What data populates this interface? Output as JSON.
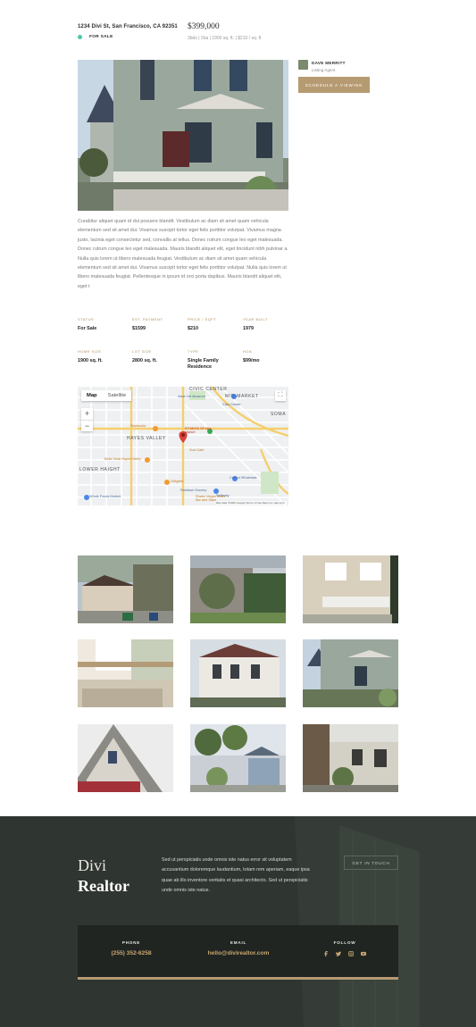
{
  "listing": {
    "address": "1234 Divi St, San Francisco, CA 92351",
    "status_badge": "FOR SALE",
    "price": "$399,000",
    "specs": "3bds | 2ba | 1900 sq. ft. | $210 / sq. ft"
  },
  "agent": {
    "name": "DAVE MERRITT",
    "role": "Listing Agent",
    "schedule_label": "SCHEDULE A VIEWING"
  },
  "description": "Curabitur aliquet quam id dui posuere blandit. Vestibulum ac diam sit amet quam vehicula elementum sed sit amet dui. Vivamus suscipit tortor eget felis porttitor volutpat. Vivamus magna justo, lacinia eget consectetur sed, convallis at tellus. Donec rutrum congue leo eget malesuada. Donec rutrum congue leo eget malesuada. Mauris blandit aliquet elit, eget tincidunt nibh pulvinar a. Nulla quis lorem ut libero malesuada feugiat. Vestibulum ac diam sit amet quam vehicula elementum sed sit amet dui. Vivamus suscipit tortor eget felis porttitor volutpat. Nulla quis lorem ut libero malesuada feugiat. Pellentesque in ipsum id orci porta dapibus. Mauris blandit aliquet elit, eget t",
  "facts": [
    {
      "label": "STATUS",
      "value": "For Sale"
    },
    {
      "label": "EST. PAYMENT",
      "value": "$1599"
    },
    {
      "label": "PRICE / SQFT",
      "value": "$210"
    },
    {
      "label": "YEAR BUILT",
      "value": "1979"
    },
    {
      "label": "HOME SIZE",
      "value": "1900 sq. ft."
    },
    {
      "label": "LOT SIZE",
      "value": "2800 sq. ft."
    },
    {
      "label": "TYPE",
      "value": "Single Family Residence"
    },
    {
      "label": "HOA",
      "value": "$99/mo"
    }
  ],
  "map": {
    "tab_map": "Map",
    "tab_satellite": "Satellite",
    "zoom_in": "+",
    "zoom_out": "−",
    "labels": {
      "civic_center": "CIVIC CENTER",
      "mid_market": "MID-MARKET",
      "hayes_valley": "HAYES VALLEY",
      "lower_haight": "LOWER HAIGHT",
      "soma": "SOMA",
      "asian_art": "Asian Art Museum",
      "civic_center_poi": "Civic Center",
      "starbucks": "Starbucks",
      "fitness": "FITNESS SF Mid-Market",
      "bella_vista": "Bella Vista Hayes Valley",
      "zuni": "Zuni Cafe",
      "costco": "Costco Wholesale",
      "safeway": "Safeway",
      "rainbow": "Rainbow Grocery",
      "whole_foods": "Whole Foods Market",
      "zeitgeist": "Zeitgeist",
      "shabu": "Shabu Vegan Sushi Bar and Sake",
      "footer": "Map data ©2020 Google   Terms of Use   Report a map error"
    },
    "colors": {
      "land": "#eef0f2",
      "road": "#ffffff",
      "major_road": "#f8d57a",
      "park": "#cfe7c6",
      "pin": "#d9433a"
    }
  },
  "footer": {
    "brand_line1": "Divi",
    "brand_line2": "Realtor",
    "text": "Sed ut perspiciatis unde omnis iste natus error sit voluptatem accusantium doloremque laudantium, totam rem aperiam, eaque ipsa quae ab illo inventore veritatis et quasi architecto. Sed ut perspiciatis unde omnis iste natus.",
    "touch_label": "GET IN TOUCH",
    "phone_label": "PHONE",
    "phone_value": "(255) 352-6258",
    "email_label": "EMAIL",
    "email_value": "hello@divirealtor.com",
    "follow_label": "FOLLOW",
    "socials": [
      "facebook-icon",
      "twitter-icon",
      "instagram-icon",
      "youtube-icon"
    ]
  },
  "colors": {
    "accent": "#b69a72",
    "status_dot": "#4fc6ac",
    "footer_bg": "#2f3531",
    "contact_bg": "#202522"
  }
}
